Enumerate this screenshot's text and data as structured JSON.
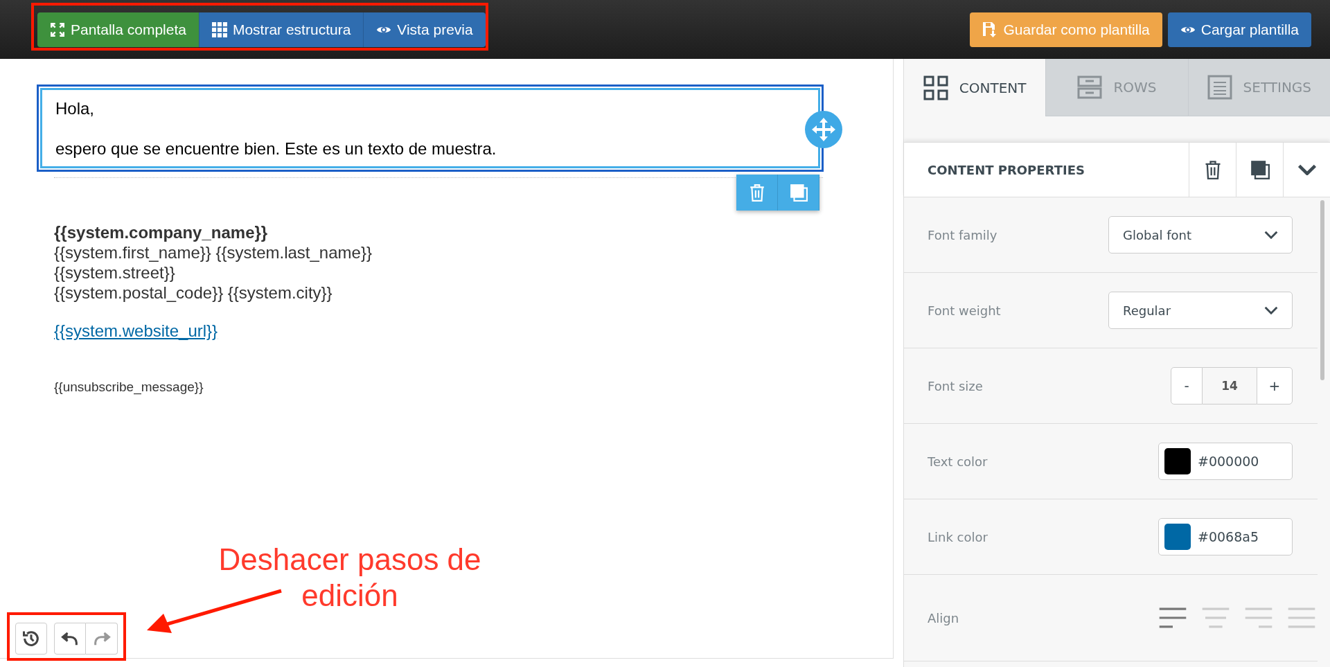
{
  "toolbar": {
    "left_buttons": [
      {
        "label": "Pantalla completa",
        "kind": "fullscreen",
        "selected": true
      },
      {
        "label": "Mostrar estructura",
        "kind": "grid",
        "selected": false
      },
      {
        "label": "Vista previa",
        "kind": "eye",
        "selected": false
      }
    ],
    "right_buttons": [
      {
        "label": "Guardar como plantilla",
        "kind": "save"
      },
      {
        "label": "Cargar plantilla",
        "kind": "eye"
      }
    ]
  },
  "editor": {
    "greeting": "Hola,",
    "body": "espero que se encuentre bien. Este es un texto de muestra.",
    "signature": [
      "{{system.company_name}}",
      "{{system.first_name}} {{system.last_name}}",
      "{{system.street}}",
      "{{system.postal_code}} {{system.city}}"
    ],
    "link": "{{system.website_url}}",
    "unsubscribe": "{{unsubscribe_message}}"
  },
  "history": [
    {
      "kind": "history",
      "disabled": false
    },
    {
      "kind": "undo",
      "disabled": false
    },
    {
      "kind": "redo",
      "disabled": true
    }
  ],
  "annotation": {
    "text": "Deshacer pasos de edición"
  },
  "panel": {
    "tabs": [
      {
        "label": "CONTENT",
        "kind": "content",
        "selected": true
      },
      {
        "label": "ROWS",
        "kind": "rows",
        "selected": false
      },
      {
        "label": "SETTINGS",
        "kind": "settings",
        "selected": false
      }
    ],
    "header": "CONTENT PROPERTIES",
    "properties": [
      {
        "kind": "select",
        "label": "Font family",
        "value": "Global font"
      },
      {
        "kind": "select",
        "label": "Font weight",
        "value": "Regular"
      },
      {
        "kind": "stepper",
        "label": "Font size",
        "value": "14",
        "minus": "-",
        "plus": "+"
      },
      {
        "kind": "color",
        "label": "Text color",
        "value": "#000000",
        "color": "#000000"
      },
      {
        "kind": "color",
        "label": "Link color",
        "value": "#0068a5",
        "color": "#0068a5"
      },
      {
        "kind": "align",
        "label": "Align",
        "options": [
          {
            "kind": "left",
            "selected": true
          },
          {
            "kind": "center",
            "selected": false
          },
          {
            "kind": "right",
            "selected": false
          },
          {
            "kind": "justify",
            "selected": false
          }
        ]
      }
    ]
  }
}
